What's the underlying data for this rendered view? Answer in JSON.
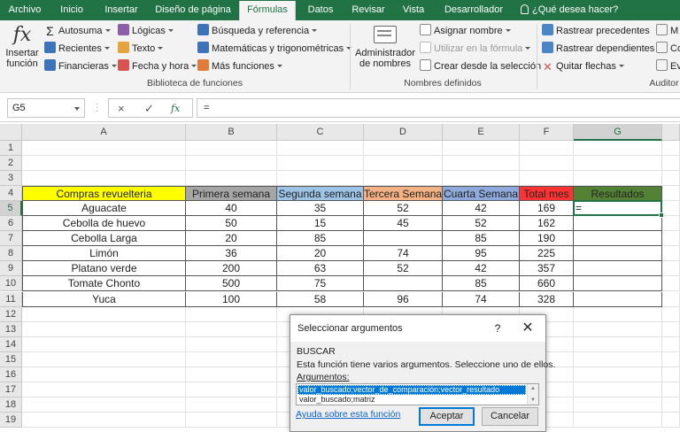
{
  "ribbon_tabs": [
    "Archivo",
    "Inicio",
    "Insertar",
    "Diseño de página",
    "Fórmulas",
    "Datos",
    "Revisar",
    "Vista",
    "Desarrollador"
  ],
  "tell_me": "¿Qué desea hacer?",
  "ribbon": {
    "insert_function": [
      "Insertar",
      "función"
    ],
    "library": {
      "col1": [
        "Autosuma",
        "Recientes",
        "Financieras"
      ],
      "col2": [
        "Lógicas",
        "Texto",
        "Fecha y hora"
      ],
      "col3": [
        "Búsqueda y referencia",
        "Matemáticas y trigonométricas",
        "Más funciones"
      ],
      "label": "Biblioteca de funciones"
    },
    "names": {
      "manager": [
        "Administrador",
        "de nombres"
      ],
      "items": [
        "Asignar nombre",
        "Utilizar en la fórmula",
        "Crear desde la selección"
      ],
      "label": "Nombres definidos"
    },
    "audit": {
      "items": [
        "Rastrear precedentes",
        "Rastrear dependientes",
        "Quitar flechas"
      ],
      "right_items": [
        "M",
        "Co",
        "Ev"
      ],
      "label": "Auditor"
    }
  },
  "formula_bar": {
    "name_box": "G5",
    "cancel": "×",
    "enter": "✓",
    "fx": "fx",
    "formula": "="
  },
  "sheet": {
    "columns": [
      "A",
      "B",
      "C",
      "D",
      "E",
      "F",
      "G"
    ],
    "row_numbers": [
      "1",
      "2",
      "3",
      "4",
      "5",
      "6",
      "7",
      "8",
      "9",
      "10",
      "11",
      "12",
      "13",
      "14",
      "15",
      "16",
      "17",
      "18",
      "19"
    ],
    "headers": [
      "Compras revuelteria",
      "Primera semana",
      "Segunda semana",
      "Tercera Semana",
      "Cuarta Semana",
      "Total mes",
      "Resultados"
    ],
    "header_colors": [
      "#ffff00",
      "#a6a6a6",
      "#9dc3e6",
      "#f4b183",
      "#8ea9db",
      "#ff3333",
      "#548235"
    ],
    "rows": [
      [
        "Aguacate",
        "40",
        "35",
        "52",
        "42",
        "169",
        "="
      ],
      [
        "Cebolla de huevo",
        "50",
        "15",
        "45",
        "52",
        "162",
        ""
      ],
      [
        "Cebolla Larga",
        "20",
        "85",
        "",
        "85",
        "190",
        ""
      ],
      [
        "Limón",
        "36",
        "20",
        "74",
        "95",
        "225",
        ""
      ],
      [
        "Platano verde",
        "200",
        "63",
        "52",
        "42",
        "357",
        ""
      ],
      [
        "Tomate Chonto",
        "500",
        "75",
        "",
        "85",
        "660",
        ""
      ],
      [
        "Yuca",
        "100",
        "58",
        "96",
        "74",
        "328",
        ""
      ]
    ]
  },
  "dialog": {
    "title": "Seleccionar argumentos",
    "help": "?",
    "close": "✕",
    "function_name": "BUSCAR",
    "description": "Esta función tiene varios argumentos. Seleccione uno de ellos.",
    "args_label": "Argumentos:",
    "options": [
      "valor_buscado;vector_de_comparación;vector_resultado",
      "valor_buscado;matriz"
    ],
    "help_link": "Ayuda sobre esta función",
    "ok": "Aceptar",
    "cancel": "Cancelar"
  }
}
